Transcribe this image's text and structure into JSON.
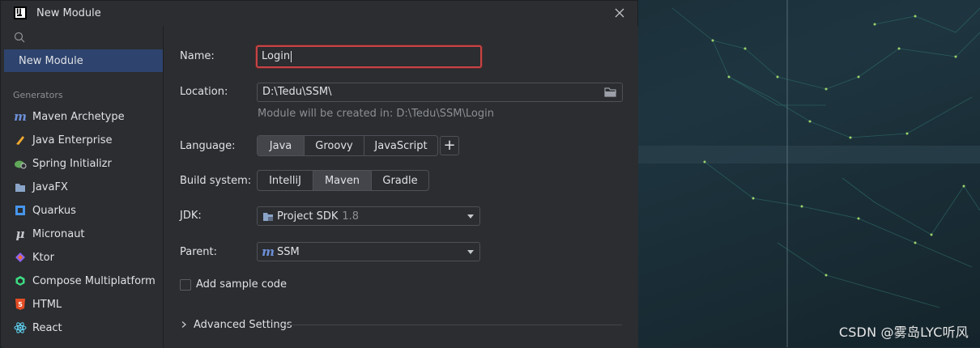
{
  "window": {
    "title": "New Module",
    "logo_text": "IJ"
  },
  "sidebar": {
    "selected_label": "New Module",
    "generators_header": "Generators",
    "generators": [
      {
        "label": "Maven Archetype",
        "icon": "maven-icon"
      },
      {
        "label": "Java Enterprise",
        "icon": "java-enterprise-icon"
      },
      {
        "label": "Spring Initializr",
        "icon": "spring-icon"
      },
      {
        "label": "JavaFX",
        "icon": "javafx-folder-icon"
      },
      {
        "label": "Quarkus",
        "icon": "quarkus-icon"
      },
      {
        "label": "Micronaut",
        "icon": "micronaut-icon"
      },
      {
        "label": "Ktor",
        "icon": "ktor-icon"
      },
      {
        "label": "Compose Multiplatform",
        "icon": "compose-icon"
      },
      {
        "label": "HTML",
        "icon": "html5-icon"
      },
      {
        "label": "React",
        "icon": "react-icon"
      }
    ]
  },
  "form": {
    "name_label": "Name:",
    "name_value": "Login",
    "location_label": "Location:",
    "location_value": "D:\\Tedu\\SSM\\",
    "location_hint": "Module will be created in: D:\\Tedu\\SSM\\Login",
    "language_label": "Language:",
    "languages": [
      "Java",
      "Groovy",
      "JavaScript"
    ],
    "language_selected": "Java",
    "add_language_symbol": "+",
    "build_label": "Build system:",
    "build_systems": [
      "IntelliJ",
      "Maven",
      "Gradle"
    ],
    "build_selected": "Maven",
    "jdk_label": "JDK:",
    "jdk_value": "Project SDK",
    "jdk_version": "1.8",
    "parent_label": "Parent:",
    "parent_value": "SSM",
    "sample_code_label": "Add sample code",
    "sample_code_checked": false,
    "advanced_label": "Advanced Settings"
  },
  "watermark": "CSDN @雾岛LYC听风",
  "colors": {
    "accent_selected": "#2e436e",
    "error_border": "#c74445",
    "dialog_bg": "#2b2d30",
    "background": "#1c2b33"
  }
}
